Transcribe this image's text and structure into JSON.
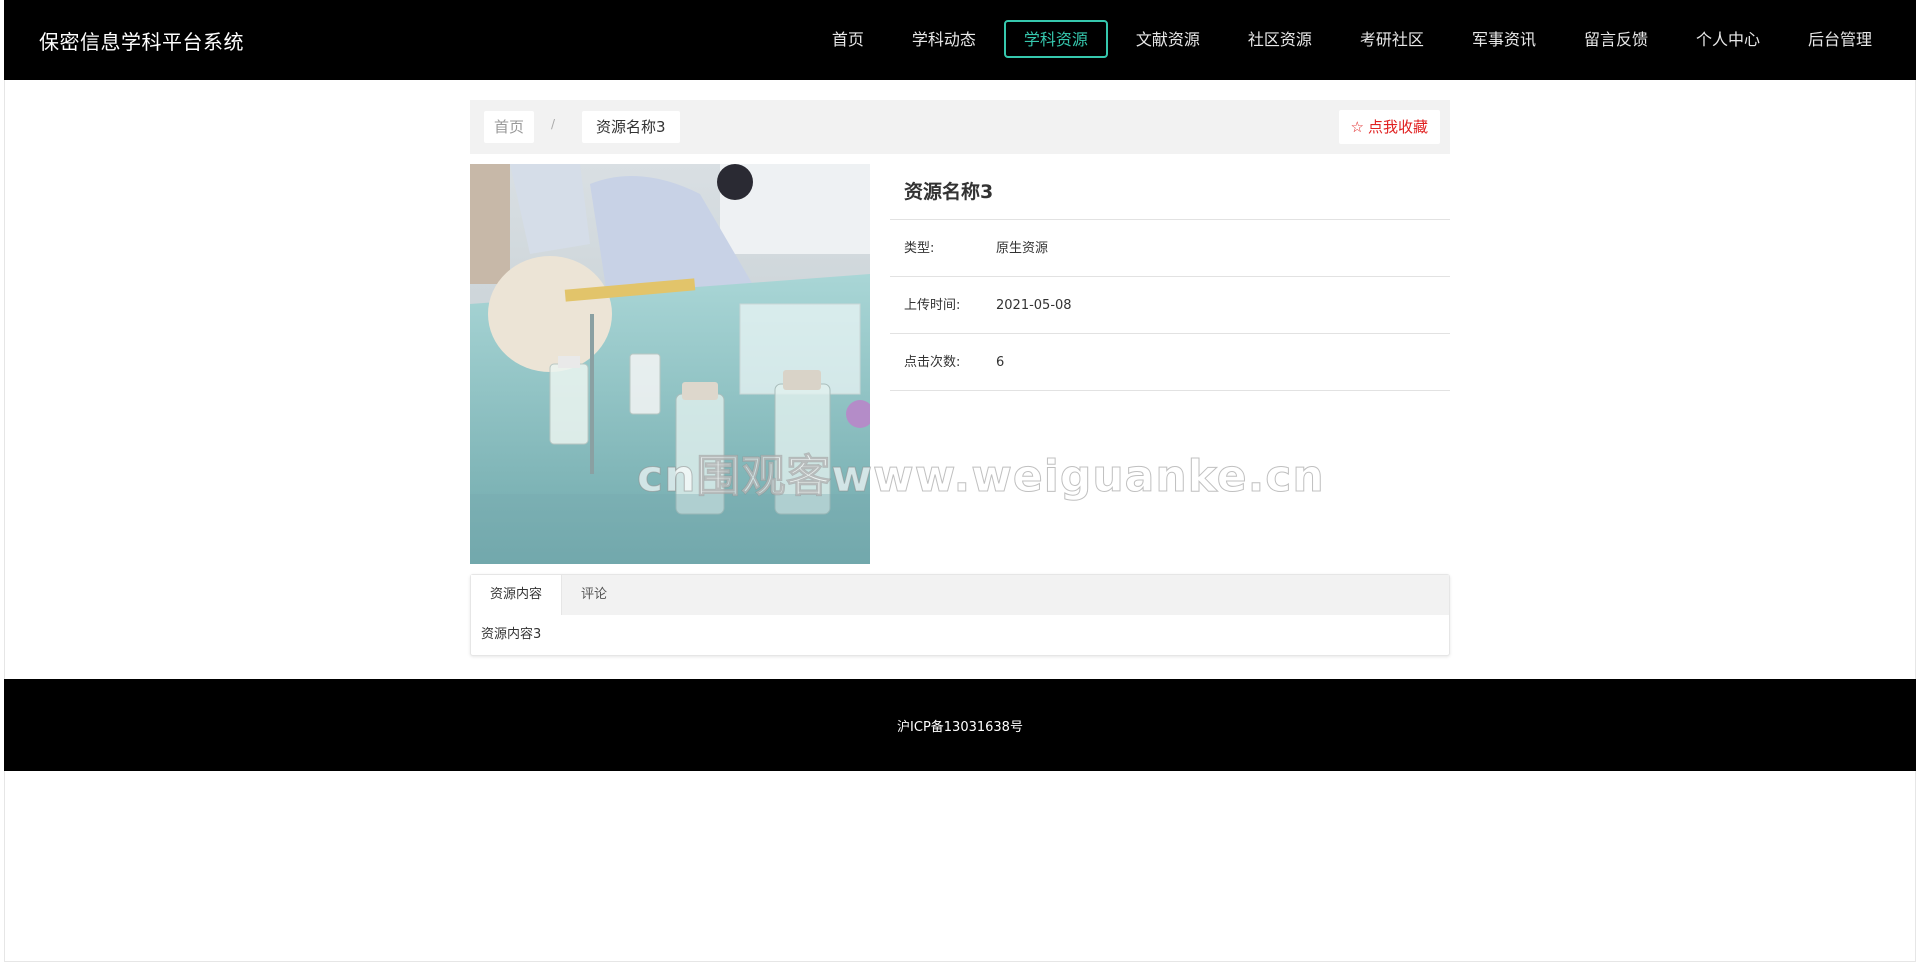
{
  "header": {
    "brand": "保密信息学科平台系统",
    "nav": [
      "首页",
      "学科动态",
      "学科资源",
      "文献资源",
      "社区资源",
      "考研社区",
      "军事资讯",
      "留言反馈",
      "个人中心",
      "后台管理"
    ],
    "active_index": 2,
    "accent_color": "#36c8ae"
  },
  "breadcrumb": {
    "home": "首页",
    "separator": "/",
    "current": "资源名称3"
  },
  "favorite": {
    "icon": "star-outline-icon",
    "label": "点我收藏",
    "color": "#e02020"
  },
  "resource": {
    "title": "资源名称3",
    "fields": [
      {
        "label": "类型:",
        "value": "原生资源"
      },
      {
        "label": "上传时间:",
        "value": "2021-05-08"
      },
      {
        "label": "点击次数:",
        "value": "6"
      }
    ]
  },
  "watermark": "cn围观客www.weiguanke.cn",
  "tabs": {
    "items": [
      "资源内容",
      "评论"
    ],
    "active_index": 0,
    "content": "资源内容3"
  },
  "footer": {
    "text": "沪ICP备13031638号"
  }
}
